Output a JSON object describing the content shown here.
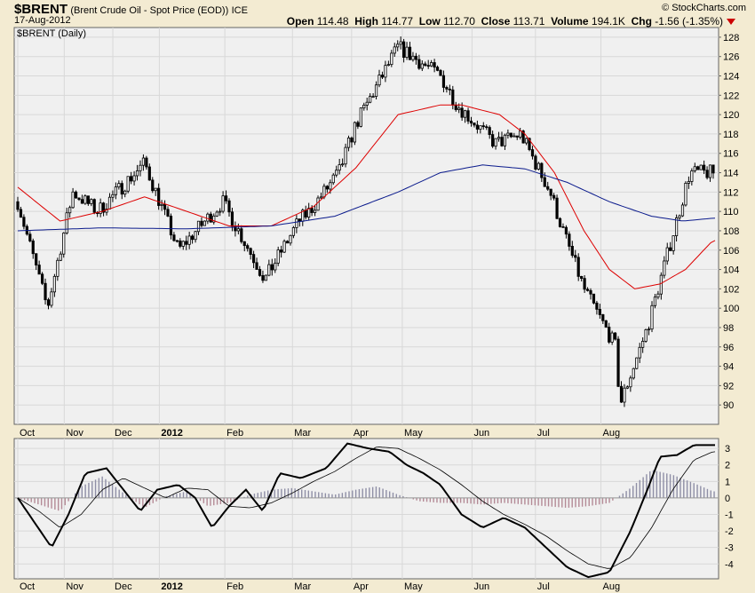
{
  "header": {
    "symbol": "$BRENT",
    "description": "(Brent Crude Oil - Spot Price (EOD))",
    "exchange": "ICE",
    "date": "17-Aug-2012",
    "watermark": "© StockCharts.com",
    "open_label": "Open",
    "open_value": "114.48",
    "high_label": "High",
    "high_value": "114.77",
    "low_label": "Low",
    "low_value": "112.70",
    "close_label": "Close",
    "close_value": "113.71",
    "volume_label": "Volume",
    "volume_value": "194.1K",
    "chg_label": "Chg",
    "chg_value": "-1.56 (-1.35%)"
  },
  "colors": {
    "background": "#f3ebd2",
    "plot_bg": "#f0f0f0",
    "candles": "#000000",
    "ma_short": "#dd0000",
    "ma_long": "#0a1a8c",
    "macd_line": "#000000",
    "signal_line": "#000000",
    "hist_positive": "#8f8fa6",
    "hist_negative": "#b48a96",
    "down_arrow": "#cc0000"
  },
  "chart_data": [
    {
      "type": "candlestick",
      "panel_label": "$BRENT (Daily)",
      "x_labels": [
        "Oct",
        "Nov",
        "Dec",
        "2012",
        "Feb",
        "Mar",
        "Apr",
        "May",
        "Jun",
        "Jul",
        "Aug"
      ],
      "ylim": [
        88,
        129
      ],
      "y_ticks": [
        90,
        92,
        94,
        96,
        98,
        100,
        102,
        104,
        106,
        108,
        110,
        112,
        114,
        116,
        118,
        120,
        122,
        124,
        126,
        128
      ],
      "grid": true,
      "series": [
        {
          "name": "price",
          "anchor_days": [
            0,
            14,
            26,
            38,
            60,
            76,
            97,
            117,
            133,
            138,
            152,
            160,
            180,
            200,
            208,
            226,
            238,
            252,
            258,
            268,
            283,
            285,
            298,
            308,
            318,
            329
          ],
          "anchor_values": [
            111,
            100,
            112,
            110,
            115,
            106,
            111,
            103,
            109,
            110,
            114,
            119,
            127,
            124,
            121,
            117,
            118,
            112,
            108,
            102,
            96,
            90,
            98,
            106,
            114,
            114
          ]
        },
        {
          "name": "short moving average",
          "anchor_days": [
            0,
            20,
            40,
            60,
            80,
            100,
            120,
            140,
            160,
            180,
            200,
            210,
            228,
            240,
            254,
            268,
            280,
            292,
            304,
            316,
            329
          ],
          "anchor_values": [
            112.5,
            109,
            110,
            111.5,
            110,
            108.5,
            108.5,
            110.5,
            114.5,
            120,
            121,
            121,
            120,
            118,
            114,
            108,
            104,
            102,
            102.5,
            104,
            107
          ]
        },
        {
          "name": "long moving average",
          "anchor_days": [
            0,
            40,
            80,
            120,
            150,
            180,
            200,
            220,
            240,
            260,
            280,
            300,
            315,
            329
          ],
          "anchor_values": [
            108,
            108.3,
            108.2,
            108.5,
            109.5,
            112,
            114,
            114.8,
            114.4,
            113,
            111,
            109.5,
            109,
            109.3
          ]
        }
      ]
    },
    {
      "type": "line",
      "ylim": [
        -4.9,
        3.6
      ],
      "y_ticks": [
        -4,
        -3,
        -2,
        -1,
        0,
        1,
        2,
        3
      ],
      "x_labels": [
        "Oct",
        "Nov",
        "Dec",
        "2012",
        "Feb",
        "Mar",
        "Apr",
        "May",
        "Jun",
        "Jul",
        "Aug"
      ],
      "grid": true,
      "series": [
        {
          "name": "macd",
          "x": [
            0,
            8,
            16,
            24,
            32,
            42,
            50,
            58,
            66,
            76,
            84,
            92,
            100,
            108,
            116,
            124,
            134,
            146,
            156,
            166,
            176,
            184,
            192,
            200,
            210,
            220,
            230,
            240,
            250,
            260,
            270,
            280,
            290,
            298,
            304,
            312,
            320,
            329
          ],
          "y": [
            0,
            -1.5,
            -3,
            -1,
            1.5,
            1.8,
            0.5,
            -0.8,
            0.5,
            0.8,
            0,
            -1.8,
            -0.5,
            0.5,
            -0.8,
            1.5,
            1.2,
            1.8,
            3.3,
            3,
            2.8,
            2,
            1.5,
            0.8,
            -1,
            -1.8,
            -1.2,
            -1.8,
            -3,
            -4.2,
            -4.8,
            -4.5,
            -2,
            0.5,
            2.5,
            2.6,
            3.2,
            3.2
          ]
        },
        {
          "name": "signal",
          "x": [
            0,
            10,
            20,
            30,
            40,
            50,
            60,
            70,
            80,
            90,
            100,
            110,
            120,
            130,
            140,
            150,
            160,
            170,
            180,
            190,
            200,
            210,
            220,
            230,
            240,
            250,
            260,
            270,
            280,
            290,
            300,
            310,
            320,
            329
          ],
          "y": [
            0,
            -0.8,
            -1.8,
            -1,
            0.5,
            1.2,
            0.6,
            0,
            0.6,
            0.5,
            -0.5,
            -0.6,
            -0.3,
            0.3,
            1,
            1.6,
            2.4,
            3.1,
            3,
            2.4,
            1.7,
            0.8,
            -0.2,
            -1,
            -1.6,
            -2.3,
            -3.2,
            -4,
            -4.3,
            -3.6,
            -1.8,
            0.5,
            2.3,
            2.8
          ]
        },
        {
          "name": "histogram",
          "x": [
            0,
            20,
            30,
            40,
            50,
            60,
            70,
            80,
            90,
            100,
            110,
            120,
            130,
            140,
            150,
            160,
            170,
            180,
            190,
            200,
            210,
            220,
            230,
            240,
            250,
            260,
            270,
            280,
            290,
            300,
            310,
            320,
            329
          ],
          "y": [
            0,
            -0.8,
            0.7,
            1.3,
            0.3,
            -0.6,
            0.1,
            0.4,
            -0.5,
            -0.3,
            0.2,
            0.5,
            0.6,
            0.4,
            0.2,
            0.5,
            0.7,
            0.2,
            -0.2,
            -0.3,
            -0.3,
            -0.4,
            -0.3,
            -0.4,
            -0.5,
            -0.6,
            -0.5,
            -0.3,
            0.6,
            1.7,
            1.4,
            0.9,
            0.4
          ]
        }
      ]
    }
  ]
}
